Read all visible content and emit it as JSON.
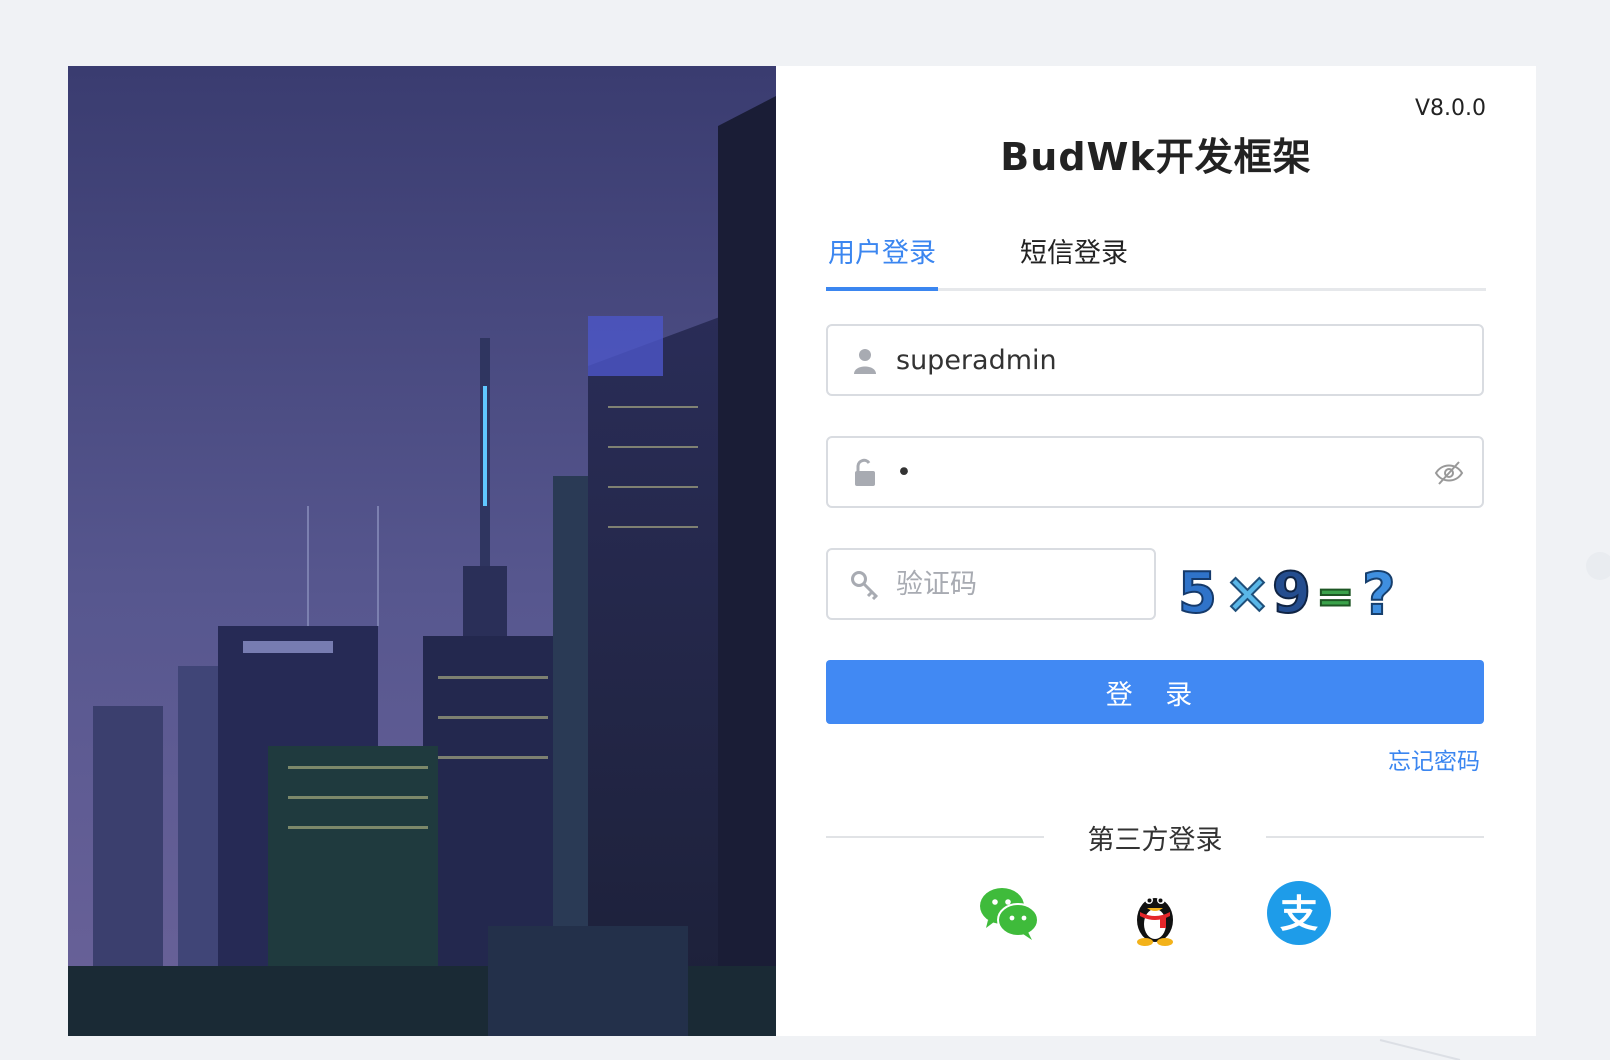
{
  "version": "V8.0.0",
  "title": "BudWk开发框架",
  "tabs": [
    {
      "label": "用户登录",
      "active": true
    },
    {
      "label": "短信登录",
      "active": false
    }
  ],
  "form": {
    "username": {
      "value": "superadmin",
      "icon": "user-icon"
    },
    "password": {
      "value": "•",
      "icon": "unlock-icon",
      "toggle_icon": "eye-off-icon"
    },
    "captcha": {
      "placeholder": "验证码",
      "icon": "key-icon",
      "image_text": "5×9=?"
    }
  },
  "login_button": "登 录",
  "forgot_password": "忘记密码",
  "third_party": {
    "label": "第三方登录",
    "providers": [
      "wechat-icon",
      "qq-icon",
      "alipay-icon"
    ]
  },
  "colors": {
    "accent": "#4189f3",
    "wechat": "#3fbb3b",
    "alipay": "#1e9ce9"
  }
}
